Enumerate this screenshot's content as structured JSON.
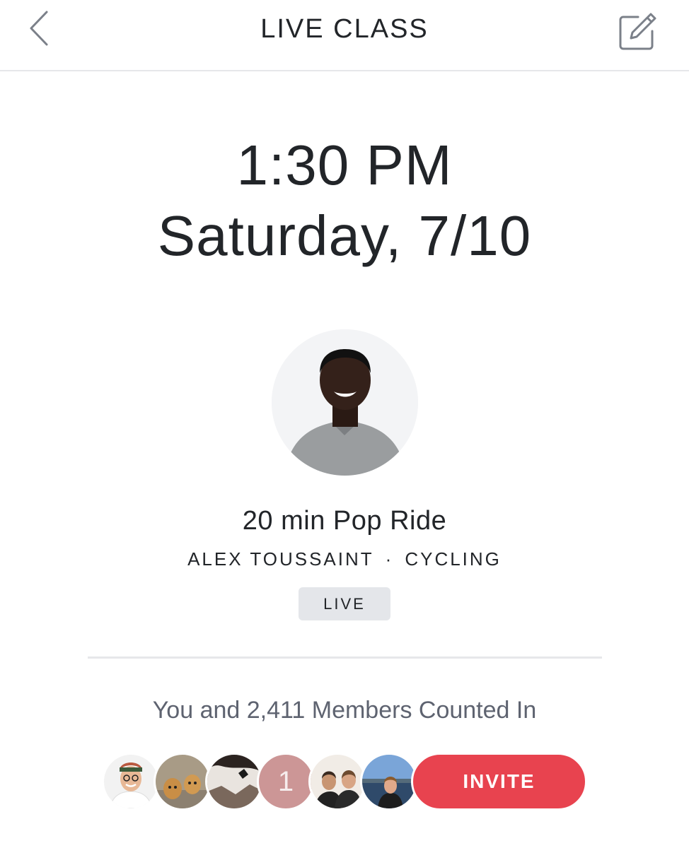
{
  "header": {
    "title": "LIVE CLASS",
    "back_icon": "chevron-left-icon",
    "edit_icon": "edit-icon"
  },
  "schedule": {
    "time": "1:30 PM",
    "date": "Saturday, 7/10"
  },
  "class": {
    "title": "20 min Pop Ride",
    "instructor": "ALEX TOUSSAINT",
    "separator": "·",
    "category": "CYCLING",
    "badge": "LIVE"
  },
  "members": {
    "text": "You and 2,411 Members Counted In",
    "count_bubble": "1",
    "invite_label": "INVITE"
  },
  "colors": {
    "accent": "#e8434f",
    "badge_bg": "#e4e6ea",
    "muted_text": "#5e6370"
  }
}
